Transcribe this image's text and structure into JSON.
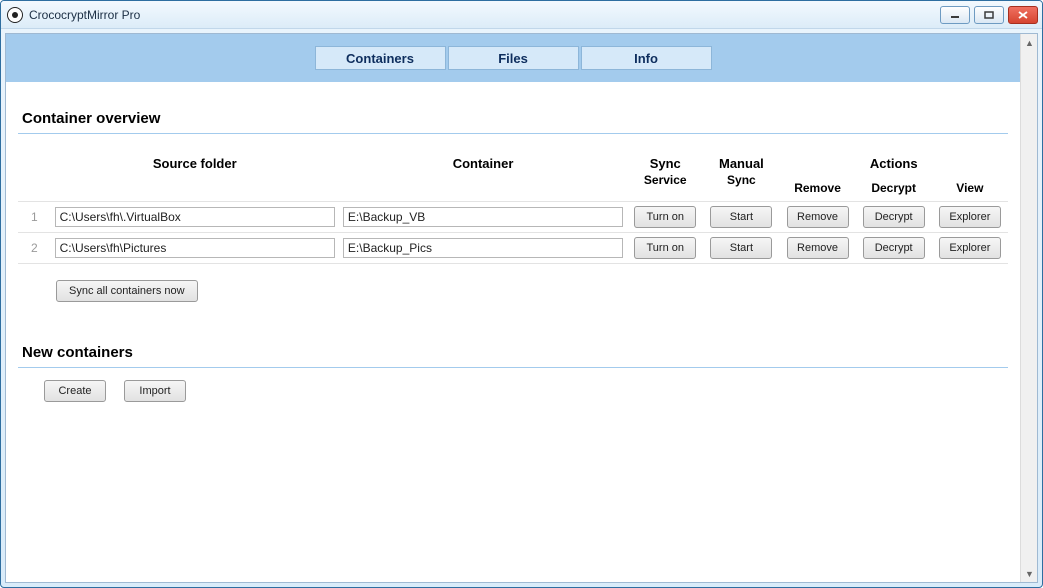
{
  "window": {
    "title": "CrococryptMirror Pro"
  },
  "tabs": {
    "containers": "Containers",
    "files": "Files",
    "info": "Info",
    "active": "containers"
  },
  "sections": {
    "overview_title": "Container overview",
    "new_title": "New containers"
  },
  "table": {
    "headers": {
      "source_folder": "Source folder",
      "container": "Container",
      "sync_service_l1": "Sync",
      "sync_service_l2": "Service",
      "manual_sync_l1": "Manual",
      "manual_sync_l2": "Sync",
      "actions": "Actions",
      "actions_remove": "Remove",
      "actions_decrypt": "Decrypt",
      "actions_view": "View"
    },
    "rows": [
      {
        "num": "1",
        "source": "C:\\Users\\fh\\.VirtualBox",
        "container": "E:\\Backup_VB",
        "sync_label": "Turn on",
        "manual_label": "Start",
        "remove_label": "Remove",
        "decrypt_label": "Decrypt",
        "view_label": "Explorer"
      },
      {
        "num": "2",
        "source": "C:\\Users\\fh\\Pictures",
        "container": "E:\\Backup_Pics",
        "sync_label": "Turn on",
        "manual_label": "Start",
        "remove_label": "Remove",
        "decrypt_label": "Decrypt",
        "view_label": "Explorer"
      }
    ],
    "sync_all_label": "Sync all containers now"
  },
  "new_containers": {
    "create_label": "Create",
    "import_label": "Import"
  }
}
